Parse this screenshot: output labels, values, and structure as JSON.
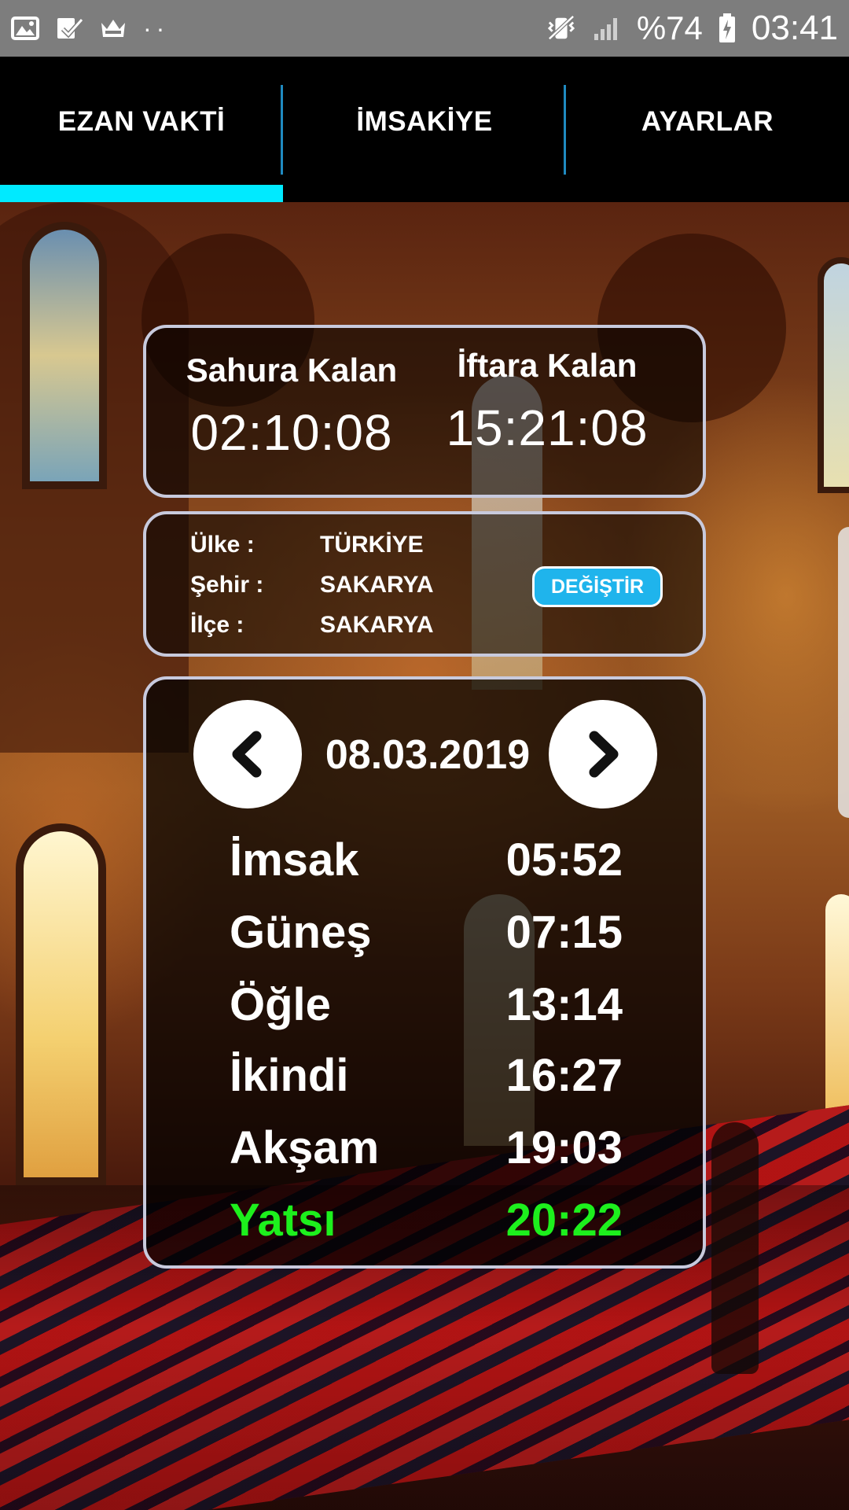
{
  "status_bar": {
    "icons_left": [
      "image-icon",
      "check-icon",
      "crown-icon"
    ],
    "dots": "··",
    "battery_percent": "%74",
    "time": "03:41"
  },
  "tabs": [
    {
      "label": "EZAN VAKTİ",
      "active": true
    },
    {
      "label": "İMSAKİYE",
      "active": false
    },
    {
      "label": "AYARLAR",
      "active": false
    }
  ],
  "countdown": {
    "sahur_label": "Sahura Kalan",
    "sahur_value": "02:10:08",
    "iftar_label": "İftara Kalan",
    "iftar_value": "15:21:08"
  },
  "location": {
    "country_label": "Ülke :",
    "country_value": "TÜRKİYE",
    "city_label": "Şehir :",
    "city_value": "SAKARYA",
    "district_label": "İlçe :",
    "district_value": "SAKARYA",
    "change_button": "DEĞİŞTİR"
  },
  "times": {
    "date": "08.03.2019",
    "rows": [
      {
        "name": "İmsak",
        "time": "05:52"
      },
      {
        "name": "Güneş",
        "time": "07:15"
      },
      {
        "name": "Öğle",
        "time": "13:14"
      },
      {
        "name": "İkindi",
        "time": "16:27"
      },
      {
        "name": "Akşam",
        "time": "19:03"
      },
      {
        "name": "Yatsı",
        "time": "20:22"
      }
    ],
    "current_index": 5
  },
  "colors": {
    "tab_indicator": "#00eaff",
    "current_prayer": "#1df01d",
    "change_button": "#1fb4ec"
  }
}
